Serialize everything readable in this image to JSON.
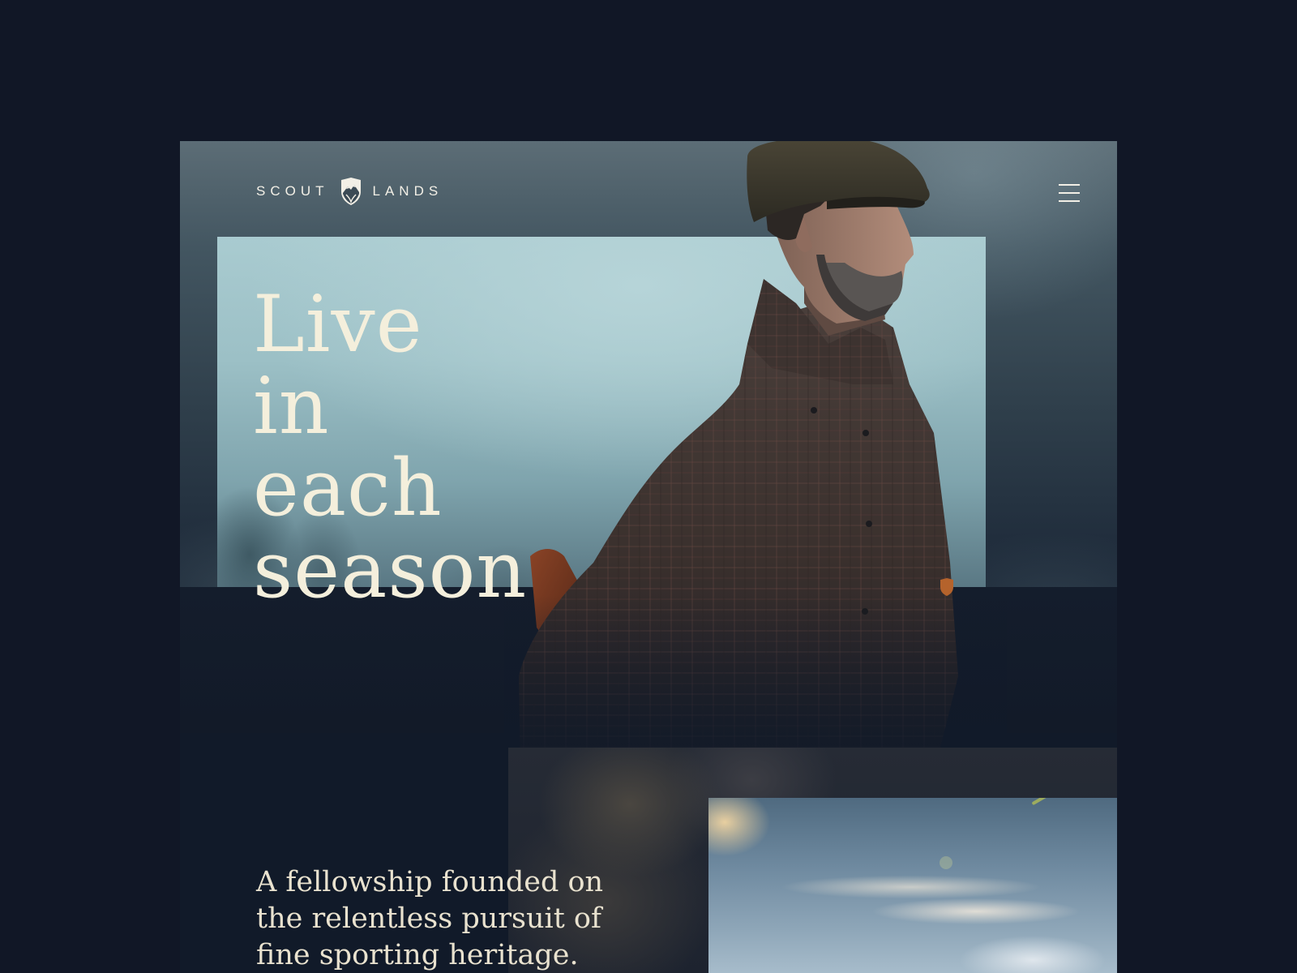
{
  "brand": {
    "name_left": "SCOUT",
    "name_right": "LANDS",
    "crest_icon": "mountain-shield-crest-icon"
  },
  "header": {
    "menu_icon": "hamburger-menu-icon"
  },
  "hero": {
    "headline_lines": [
      "Live",
      "in",
      "each",
      "season"
    ],
    "image": "man-in-flat-cap-and-tweed-coat-with-shotgun",
    "marker_icon": "shield-icon"
  },
  "intro": {
    "tagline": "A fellowship founded on the relentless pursuit of fine sporting heritage.",
    "image": "sunset-sky-with-clouds"
  },
  "colors": {
    "page_background": "#111726",
    "headline": "#f4efdc",
    "accent_copper": "#b5632c",
    "logo": "#f2efe6"
  }
}
